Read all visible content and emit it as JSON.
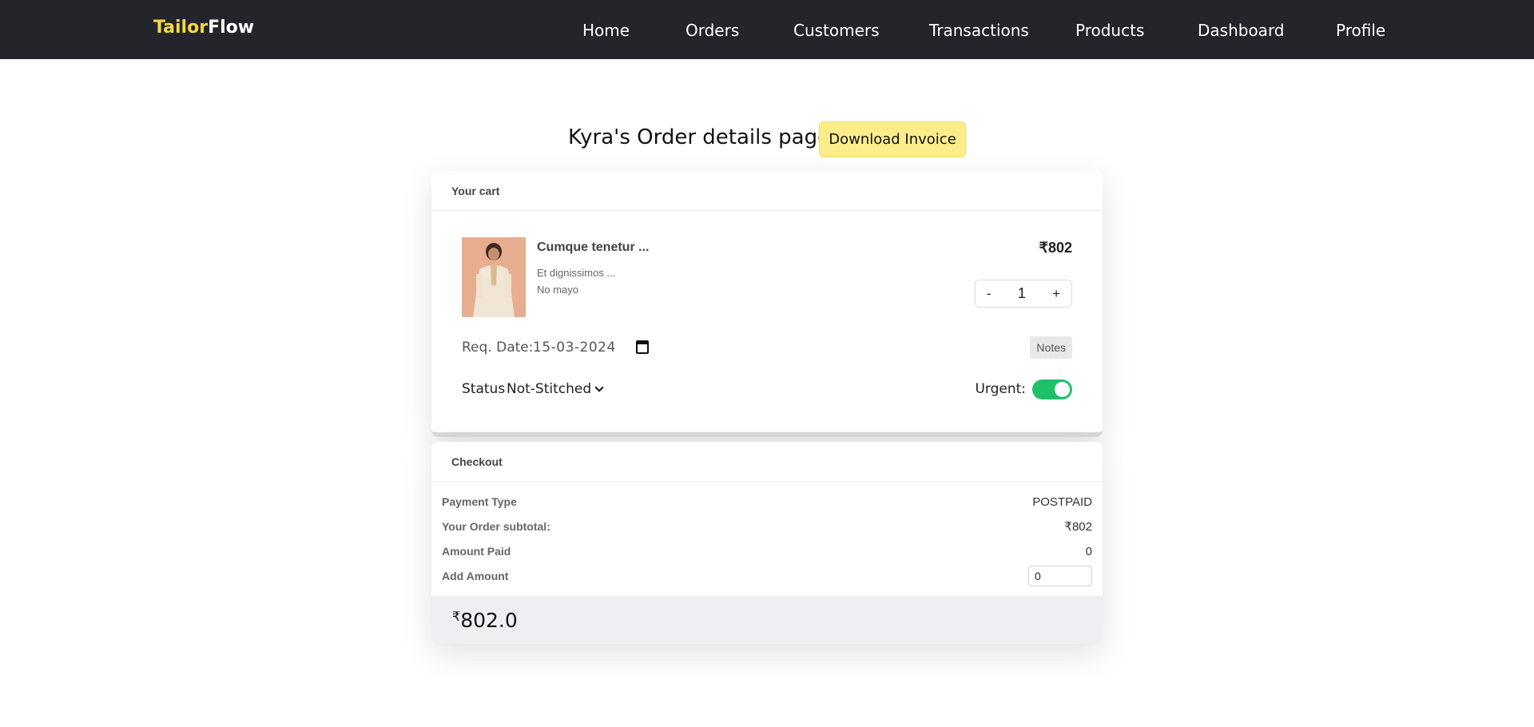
{
  "brand": {
    "part1": "Tailor",
    "part2": "Flow"
  },
  "nav": {
    "items": [
      "Home",
      "Orders",
      "Customers",
      "Transactions",
      "Products",
      "Dashboard",
      "Profile"
    ]
  },
  "page": {
    "title": "Kyra's Order details page",
    "download_label": "Download Invoice"
  },
  "cart": {
    "header": "Your cart",
    "item": {
      "name": "Cumque tenetur ...",
      "description": "Et dignissimos ...",
      "variant": "No mayo",
      "price": "₹802",
      "quantity": "1",
      "qty_minus": "-",
      "qty_plus": "+"
    },
    "req_date_label": "Req. Date:",
    "req_date_value": "15-03-2024",
    "notes_label": "Notes",
    "status_label": "Status",
    "status_value": "Not-Stitched",
    "urgent_label": "Urgent:",
    "urgent_on": true
  },
  "checkout": {
    "header": "Checkout",
    "payment_type_label": "Payment Type",
    "payment_type_value": "POSTPAID",
    "subtotal_label": "Your Order subtotal:",
    "subtotal_value": "₹802",
    "amount_paid_label": "Amount Paid",
    "amount_paid_value": "0",
    "add_amount_label": "Add Amount",
    "add_amount_value": "0",
    "total_currency": "₹",
    "total_value": "802.0"
  },
  "colors": {
    "navbar_bg": "#23252b",
    "brand_accent": "#f5d64a",
    "download_bg": "#fced8a",
    "toggle_on": "#1fc06a"
  },
  "icons": {
    "calendar": "calendar-icon",
    "status_dropdown": "chevron-down-icon"
  }
}
